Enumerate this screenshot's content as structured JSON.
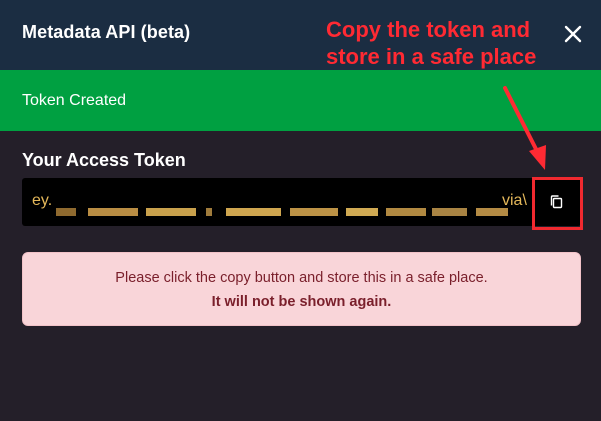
{
  "modal": {
    "title": "Metadata API (beta)"
  },
  "alert_success": {
    "text": "Token Created"
  },
  "token_section": {
    "label": "Your Access Token",
    "token_prefix": "ey.",
    "token_suffix": "via\\"
  },
  "warning": {
    "line1": "Please click the copy button and store this in a safe place.",
    "line2": "It will not be shown again."
  },
  "annotation": {
    "line1": "Copy the token and",
    "line2": "store in a safe place"
  },
  "icons": {
    "close": "close-icon",
    "copy": "copy-icon"
  },
  "colors": {
    "header_bg": "#1b2d42",
    "body_bg": "#241f29",
    "success_bg": "#00a041",
    "token_text": "#e4b85a",
    "warning_bg": "#f9d5d9",
    "warning_text": "#7a1f2b",
    "annotation_red": "#ff2a33"
  }
}
